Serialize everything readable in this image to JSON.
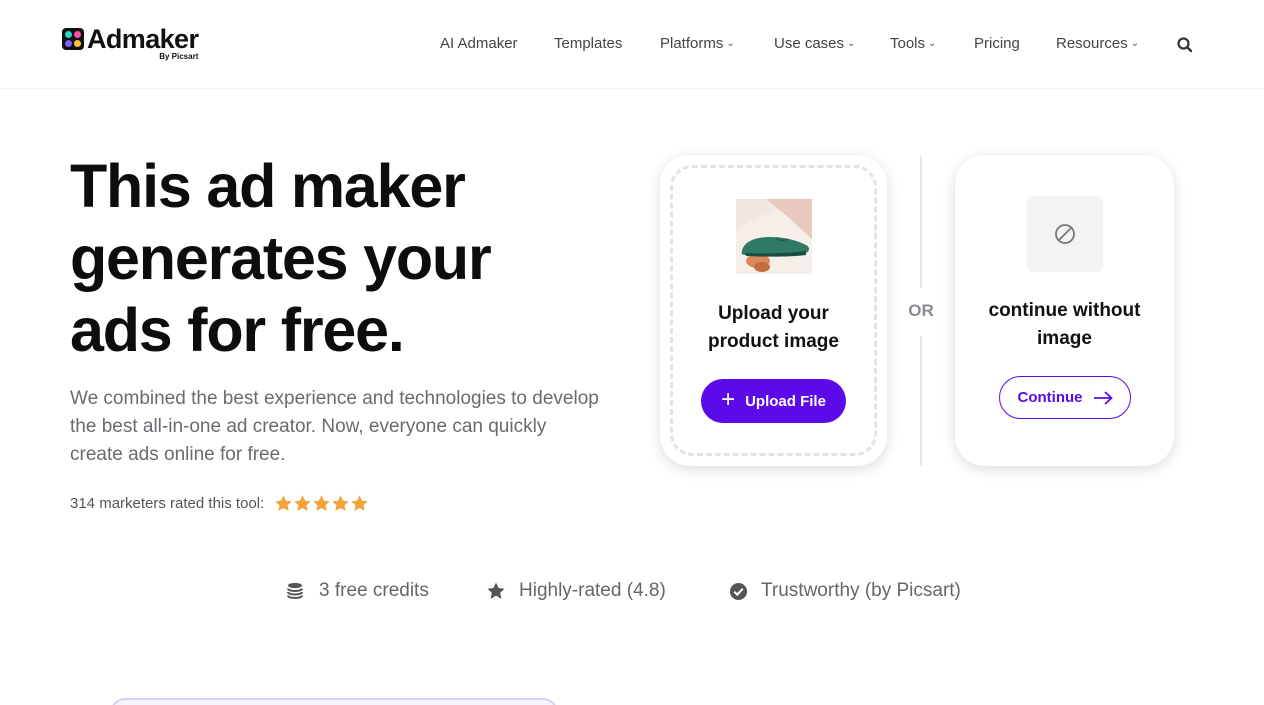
{
  "brand": {
    "name": "Admaker",
    "byline": "By Picsart",
    "colors": {
      "primary": "#5a0be8",
      "star": "#f2a33a"
    }
  },
  "nav": {
    "items": [
      {
        "label": "AI Admaker",
        "has_dropdown": false
      },
      {
        "label": "Templates",
        "has_dropdown": false
      },
      {
        "label": "Platforms",
        "has_dropdown": true
      },
      {
        "label": "Use cases",
        "has_dropdown": true
      },
      {
        "label": "Tools",
        "has_dropdown": true
      },
      {
        "label": "Pricing",
        "has_dropdown": false
      },
      {
        "label": "Resources",
        "has_dropdown": true
      }
    ],
    "search_icon": "search-icon"
  },
  "hero": {
    "title_lines": [
      "This ad maker",
      "generates your",
      "ads for free."
    ],
    "description": "We combined the best experience and technologies to develop the best all-in-one ad creator. Now, everyone can quickly create ads online for free.",
    "rating_text": "314 marketers rated this tool:",
    "rating_stars": 5
  },
  "upload_card": {
    "title_line1": "Upload your",
    "title_line2": "product image",
    "button_label": "Upload File",
    "button_icon": "plus-icon"
  },
  "separator": {
    "label": "OR"
  },
  "continue_card": {
    "title_line1": "continue without",
    "title_line2": "image",
    "button_label": "Continue",
    "icon": "no-image-icon",
    "button_icon": "arrow-right-icon"
  },
  "features": [
    {
      "label": "3 free credits",
      "icon": "coins-icon"
    },
    {
      "label": "Highly-rated (4.8)",
      "icon": "star-icon"
    },
    {
      "label": "Trustworthy (by Picsart)",
      "icon": "check-circle-icon"
    }
  ]
}
